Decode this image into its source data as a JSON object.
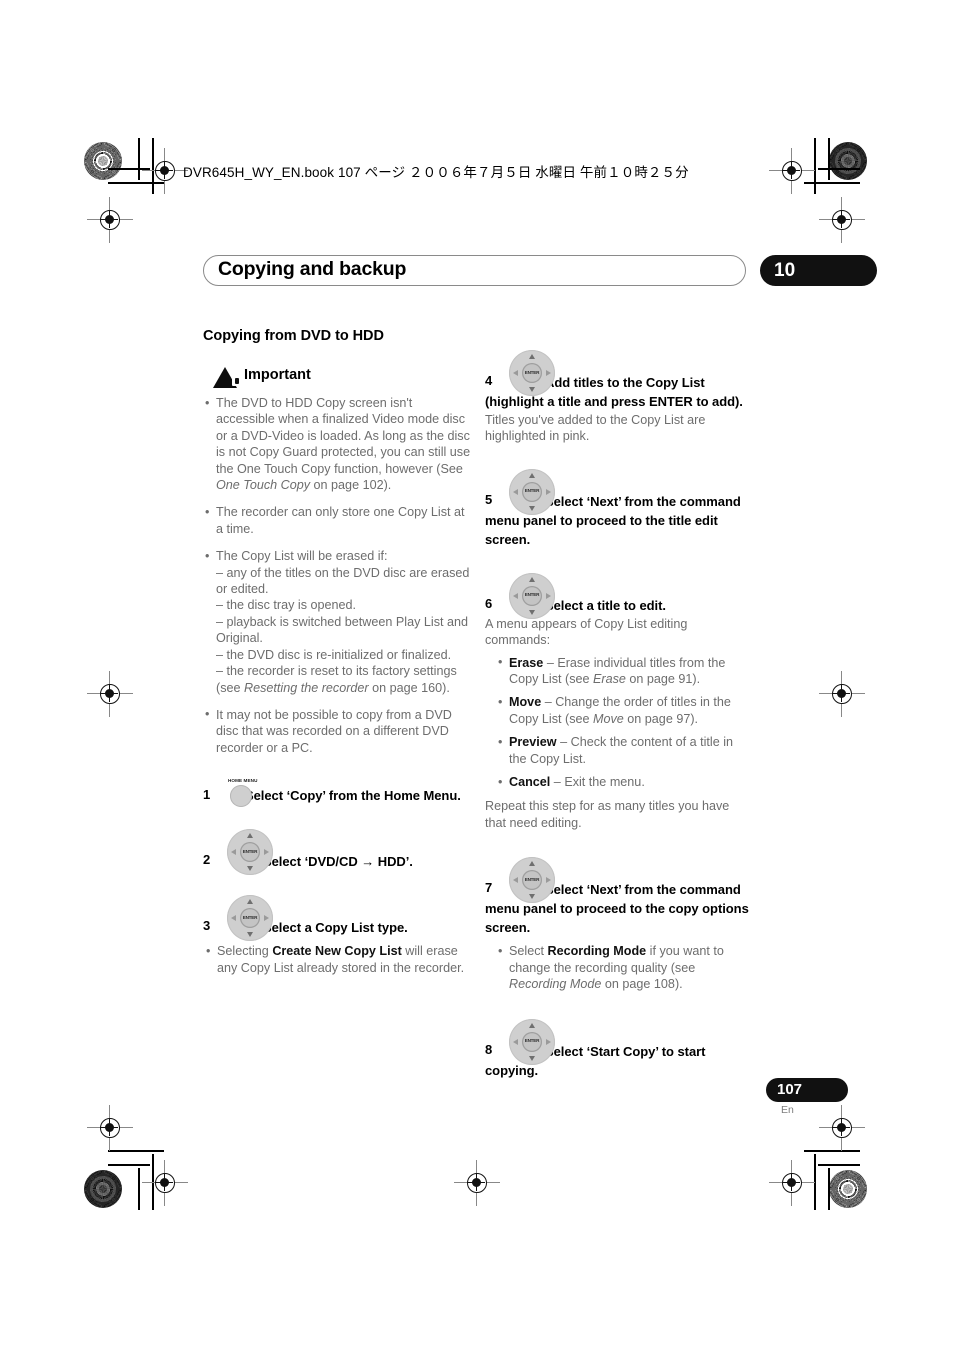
{
  "printmarks": {
    "filename_header": "DVR645H_WY_EN.book   107 ページ   ２００６年７月５日   水曜日   午前１０時２５分"
  },
  "chapter": {
    "title": "Copying and backup",
    "number": "10"
  },
  "left_column": {
    "section_heading": "Copying from DVD to HDD",
    "important": {
      "icon": "warning-triangle-icon",
      "label": "Important",
      "bullets": [
        "The DVD to HDD Copy screen isn't accessible when a finalized Video mode disc or a DVD-Video is loaded. As long as the disc is not Copy Guard protected, you can still use the One Touch Copy function, however (See ",
        "The recorder can only store one Copy List at a time."
      ],
      "bullet1_italic": "One Touch Copy",
      "bullet1_tail": " on page 102).",
      "bullet3_lead": "The Copy List will be erased if:",
      "bullet3_dashes": [
        "– any of the titles on the DVD disc are erased or edited.",
        "– the disc tray is opened.",
        "– playback is switched between Play List and Original.",
        "– the DVD disc is re-initialized or finalized.",
        "– the recorder is reset to its factory settings (see "
      ],
      "bullet3_italic": "Resetting the recorder",
      "bullet3_tail": " on page 160).",
      "bullet4": "It may not be possible to copy from a DVD disc that was recorded on a different DVD recorder or a PC."
    },
    "steps": [
      {
        "num": "1",
        "icon": "home-menu-button-icon",
        "icon_label": "HOME MENU",
        "heading": "Select ‘Copy’ from the Home Menu."
      },
      {
        "num": "2",
        "icon": "dpad-enter-icon",
        "heading": "Select ‘DVD/CD → HDD’."
      },
      {
        "num": "3",
        "icon": "dpad-enter-icon",
        "heading": "Select a Copy List type.",
        "bullet_lead": "Selecting ",
        "bullet_bold": "Create New Copy List",
        "bullet_tail": " will erase any Copy List already stored in the recorder."
      }
    ]
  },
  "right_column": {
    "steps": [
      {
        "num": "4",
        "icon": "dpad-enter-icon",
        "heading": "Add titles to the Copy List (highlight a title and press ENTER to add).",
        "body": "Titles you've added to the Copy List are highlighted in pink."
      },
      {
        "num": "5",
        "icon": "dpad-enter-icon",
        "heading": "Select ‘Next’ from the command menu panel to proceed to the title edit screen."
      },
      {
        "num": "6",
        "icon": "dpad-enter-icon",
        "heading": "Select a title to edit.",
        "body": "A menu appears of Copy List editing commands:",
        "commands": [
          {
            "name": "Erase",
            "desc_lead": " – Erase individual titles from the Copy List (see ",
            "desc_italic": "Erase",
            "desc_tail": " on page 91)."
          },
          {
            "name": "Move",
            "desc_lead": " – Change the order of titles in the Copy List (see ",
            "desc_italic": "Move",
            "desc_tail": " on page 97)."
          },
          {
            "name": "Preview",
            "desc_lead": " – Check the content of a title in the Copy List.",
            "desc_italic": "",
            "desc_tail": ""
          },
          {
            "name": "Cancel",
            "desc_lead": " – Exit the menu.",
            "desc_italic": "",
            "desc_tail": ""
          }
        ],
        "footer": "Repeat this step for as many titles you have that need editing."
      },
      {
        "num": "7",
        "icon": "dpad-enter-icon",
        "heading": "Select ‘Next’ from the command menu panel to proceed to the copy options screen.",
        "bullet_lead": "Select ",
        "bullet_bold": "Recording Mode",
        "bullet_mid": " if you want to change the recording quality (see ",
        "bullet_italic": "Recording Mode",
        "bullet_tail": " on page 108)."
      },
      {
        "num": "8",
        "icon": "dpad-enter-icon",
        "heading": "Select ‘Start Copy’ to start copying."
      }
    ]
  },
  "footer": {
    "page_number": "107",
    "language": "En"
  },
  "dpad": {
    "enter_label": "ENTER"
  }
}
